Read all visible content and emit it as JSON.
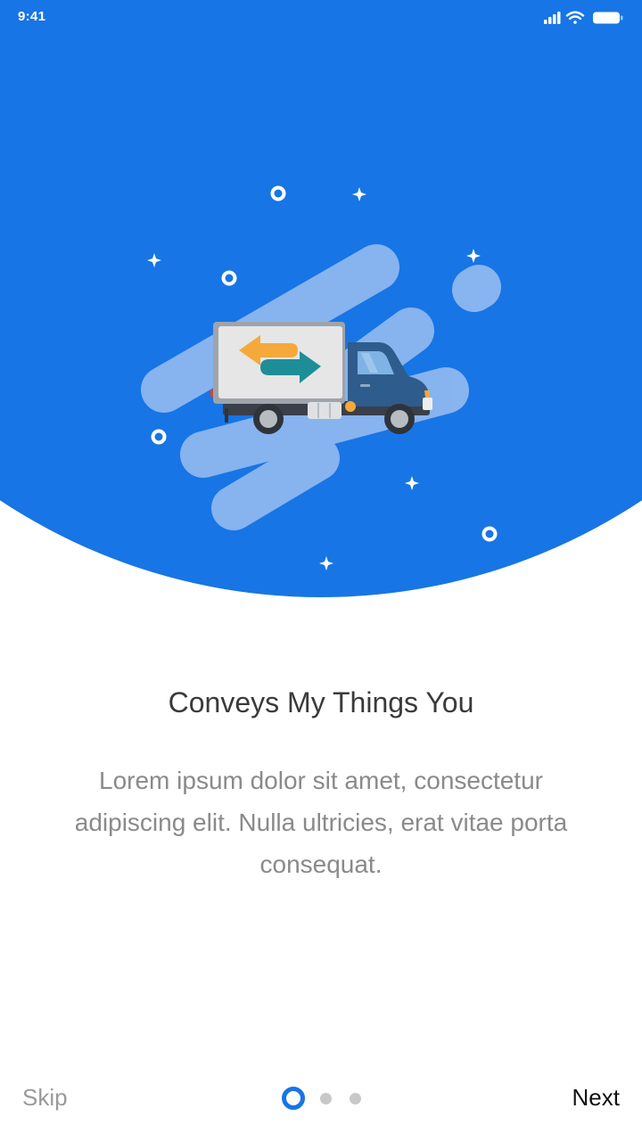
{
  "status_bar": {
    "time": "9:41",
    "icons": [
      "signal-icon",
      "wifi-icon",
      "battery-icon"
    ]
  },
  "onboarding": {
    "illustration": "delivery-truck",
    "title": "Conveys My Things You",
    "description": "Lorem ipsum dolor sit amet, consectetur adipiscing elit. Nulla ultricies, erat vitae porta consequat."
  },
  "footer": {
    "skip_label": "Skip",
    "next_label": "Next",
    "page_count": 3,
    "current_page": 1
  },
  "colors": {
    "primary": "#1775E5",
    "title_text": "#3a3a3a",
    "body_text": "#8a8a8a",
    "inactive_dot": "#c8c8c8"
  }
}
